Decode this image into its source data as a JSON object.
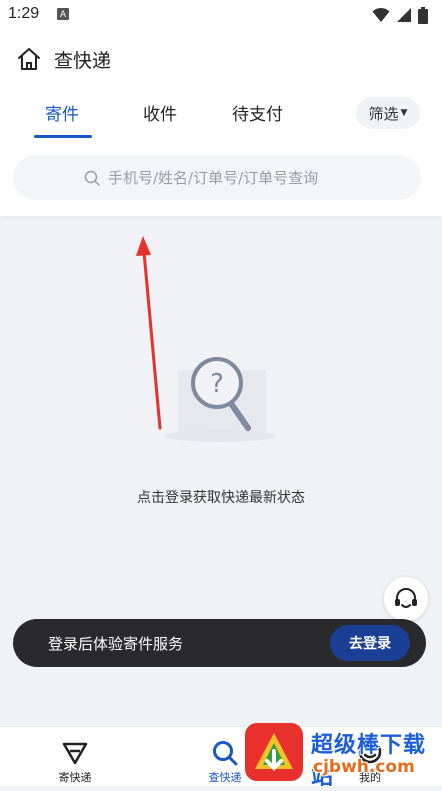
{
  "status_bar": {
    "time": "1:29",
    "indicator": "A"
  },
  "header": {
    "title": "查快递",
    "tabs": [
      {
        "label": "寄件",
        "active": true
      },
      {
        "label": "收件",
        "active": false
      },
      {
        "label": "待支付",
        "active": false
      }
    ],
    "filter_label": "筛选",
    "search_placeholder": "手机号/姓名/订单号/订单号查询"
  },
  "empty_state": {
    "message": "点击登录获取快递最新状态"
  },
  "login_banner": {
    "text": "登录后体验寄件服务",
    "button_label": "去登录"
  },
  "bottom_nav": [
    {
      "label": "寄快递",
      "icon": "send-icon",
      "active": false
    },
    {
      "label": "查快递",
      "icon": "search-icon",
      "active": true
    },
    {
      "label": "我的",
      "icon": "profile-icon",
      "active": false
    }
  ],
  "watermark": {
    "title": "超级棒下载站",
    "url": "cjbwh.com"
  },
  "colors": {
    "accent": "#1a56c4",
    "banner_bg": "#2a2a2d",
    "login_button": "#1a3f94",
    "page_bg": "#f1f2f6",
    "annotation_arrow": "#e8302c"
  }
}
